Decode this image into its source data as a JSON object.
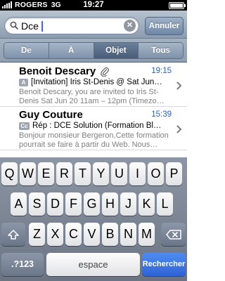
{
  "status_bar": {
    "carrier": "ROGERS",
    "network": "3G",
    "time": "19:27",
    "battery_level_percent": 100
  },
  "search": {
    "value": "Dce",
    "clear_icon": "clear-x-icon",
    "cancel_label": "Annuler"
  },
  "scope": {
    "tabs": [
      {
        "label": "De"
      },
      {
        "label": "À"
      },
      {
        "label": "Objet"
      },
      {
        "label": "Tous"
      }
    ],
    "selected": "Objet"
  },
  "results": [
    {
      "sender": "Benoit Descary",
      "time": "19:15",
      "badge": "A",
      "has_attachment": true,
      "subject": "[Invitation] Iris St-Denis @ Sat Jun…",
      "preview": "Benoit Descary, you are invited to Iris St-Denis Sat Jun 20 11am – 12pm (Timezo…"
    },
    {
      "sender": "Guy Couture",
      "time": "15:39",
      "badge": "Cc",
      "has_attachment": false,
      "subject": "Rép : DCE Solution (Formation Bl…",
      "preview": "Bonjour monsieur Bergeron,Cette formation pourrait se faire à partir du Web. Nous…"
    }
  ],
  "keyboard": {
    "row1": [
      "Q",
      "W",
      "E",
      "R",
      "T",
      "Y",
      "U",
      "I",
      "O",
      "P"
    ],
    "row2": [
      "A",
      "S",
      "D",
      "F",
      "G",
      "H",
      "J",
      "K",
      "L"
    ],
    "row3": [
      "Z",
      "X",
      "C",
      "V",
      "B",
      "N",
      "M"
    ],
    "shift_icon": "shift-arrow-icon",
    "delete_icon": "backspace-icon",
    "numbers_label": ".?123",
    "space_label": "espace",
    "search_label": "Rechercher"
  },
  "colors": {
    "link_blue": "#2a62c9",
    "go_key_blue": "#2f63d6",
    "selected_segment": "#485c77"
  }
}
